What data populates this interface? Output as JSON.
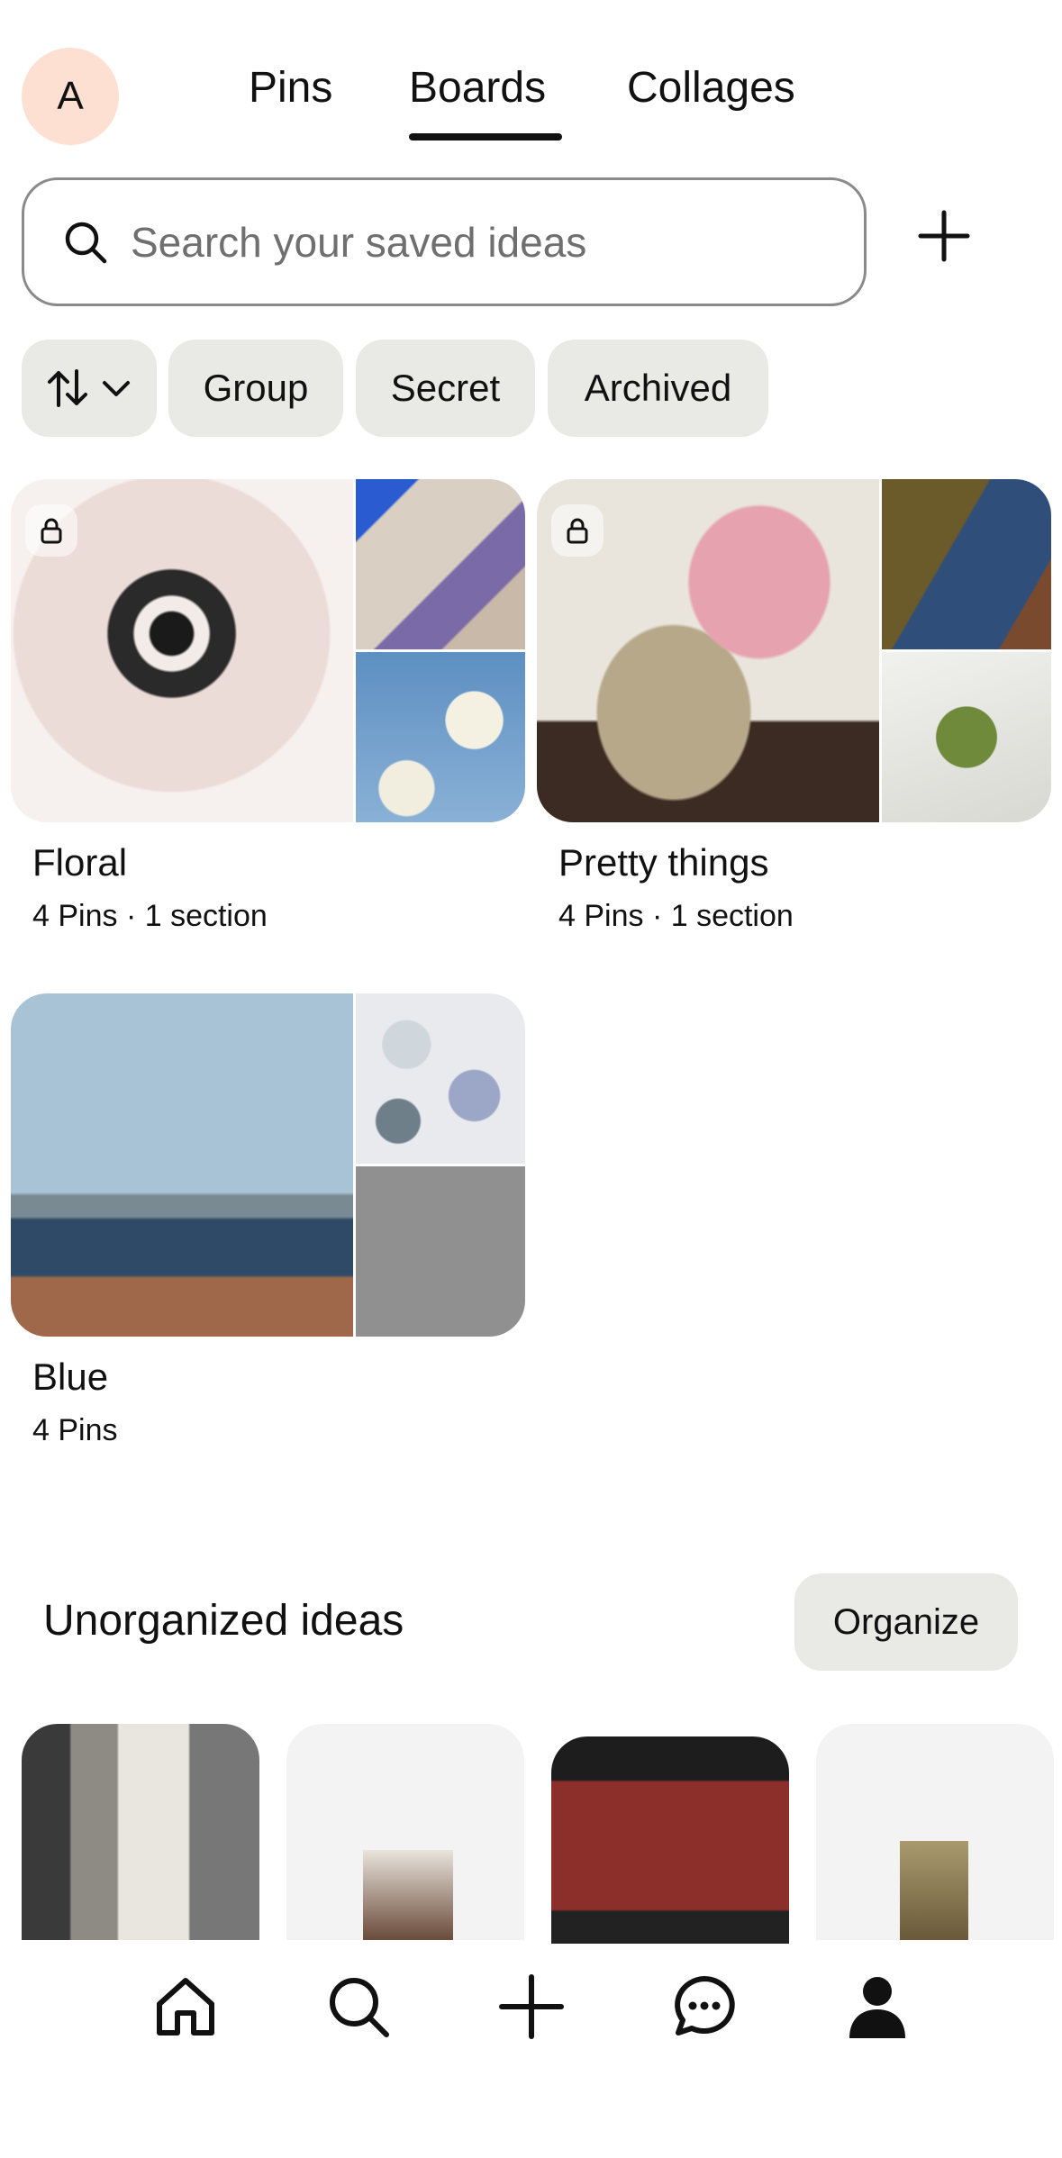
{
  "header": {
    "avatar_initial": "A",
    "tabs": [
      {
        "label": "Pins",
        "active": false
      },
      {
        "label": "Boards",
        "active": true
      },
      {
        "label": "Collages",
        "active": false
      }
    ]
  },
  "search": {
    "placeholder": "Search your saved ideas",
    "icon": "search-icon",
    "add_icon": "plus-icon"
  },
  "filters": {
    "sort_icon": "sort-arrows-icon",
    "chips": [
      "Group",
      "Secret",
      "Archived"
    ]
  },
  "boards": [
    {
      "title": "Floral",
      "meta": "4 Pins · 1 section",
      "secret": true
    },
    {
      "title": "Pretty things",
      "meta": "4 Pins · 1 section",
      "secret": true
    },
    {
      "title": "Blue",
      "meta": "4 Pins",
      "secret": false
    }
  ],
  "unorganized": {
    "title": "Unorganized ideas",
    "organize_label": "Organize"
  },
  "bottom_nav": {
    "items": [
      "home-icon",
      "search-icon",
      "create-icon",
      "messages-icon",
      "profile-icon"
    ]
  },
  "colors": {
    "avatar_bg": "#fde0d1",
    "chip_bg": "#e9e9e6",
    "text": "#111111"
  }
}
